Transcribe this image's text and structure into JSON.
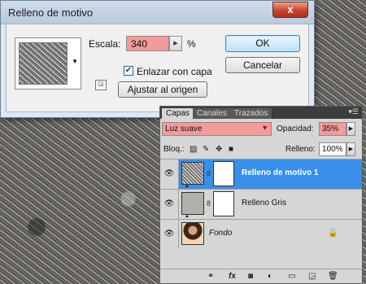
{
  "dialog": {
    "title": "Relleno de motivo",
    "close_label": "x",
    "scale_label": "Escala:",
    "scale_value": "340",
    "scale_unit": "%",
    "link_label": "Enlazar con capa",
    "link_checked": true,
    "snap_button": "Ajustar al origen",
    "ok_button": "OK",
    "cancel_button": "Cancelar"
  },
  "layers_panel": {
    "tabs": [
      "Capas",
      "Canales",
      "Trazados"
    ],
    "active_tab": "Capas",
    "blend_mode": "Luz suave",
    "opacity_label": "Opacidad:",
    "opacity_value": "35%",
    "lock_label": "Bloq.:",
    "fill_label": "Relleno:",
    "fill_value": "100%",
    "layers": [
      {
        "name": "Relleno de motivo 1",
        "thumbnail": "pattern",
        "selected": true,
        "has_mask": true
      },
      {
        "name": "Relleno Gris",
        "thumbnail": "gray",
        "selected": false,
        "has_mask": true
      },
      {
        "name": "Fondo",
        "thumbnail": "photo",
        "selected": false,
        "locked": true
      }
    ]
  },
  "colors": {
    "highlight_field": "#f49a9a",
    "selected_layer": "#3a8fe8",
    "dialog_bg": "#f0f0f0"
  }
}
